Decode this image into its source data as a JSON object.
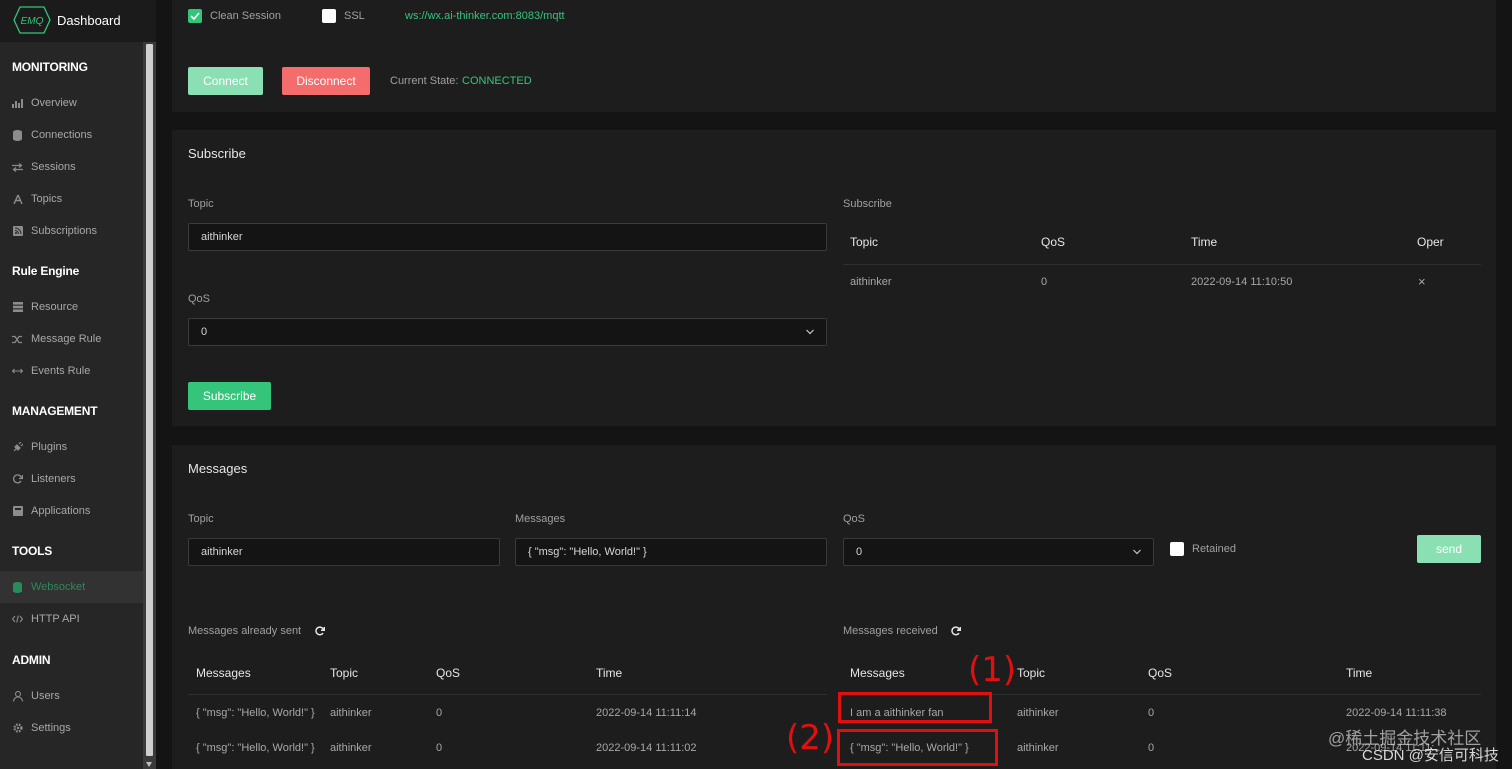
{
  "brand": {
    "logo_text": "EMQ",
    "title": "Dashboard"
  },
  "sidebar": {
    "sections": [
      {
        "label": "MONITORING",
        "items": [
          {
            "label": "Overview",
            "icon": "chart-icon"
          },
          {
            "label": "Connections",
            "icon": "database-icon"
          },
          {
            "label": "Sessions",
            "icon": "swap-icon"
          },
          {
            "label": "Topics",
            "icon": "tower-icon"
          },
          {
            "label": "Subscriptions",
            "icon": "rss-icon"
          }
        ]
      },
      {
        "label": "Rule Engine",
        "items": [
          {
            "label": "Resource",
            "icon": "server-icon"
          },
          {
            "label": "Message Rule",
            "icon": "shuffle-icon"
          },
          {
            "label": "Events Rule",
            "icon": "arrows-h-icon"
          }
        ]
      },
      {
        "label": "MANAGEMENT",
        "items": [
          {
            "label": "Plugins",
            "icon": "plug-icon"
          },
          {
            "label": "Listeners",
            "icon": "refresh-icon"
          },
          {
            "label": "Applications",
            "icon": "app-icon"
          }
        ]
      },
      {
        "label": "TOOLS",
        "items": [
          {
            "label": "Websocket",
            "icon": "websocket-icon",
            "active": true
          },
          {
            "label": "HTTP API",
            "icon": "code-icon"
          }
        ]
      },
      {
        "label": "ADMIN",
        "items": [
          {
            "label": "Users",
            "icon": "user-icon"
          },
          {
            "label": "Settings",
            "icon": "gear-icon"
          }
        ]
      }
    ]
  },
  "connection": {
    "clean_session_label": "Clean Session",
    "ssl_label": "SSL",
    "url": "ws://wx.ai-thinker.com:8083/mqtt",
    "connect_label": "Connect",
    "disconnect_label": "Disconnect",
    "state_label": "Current State:",
    "state_value": "CONNECTED"
  },
  "subscribe": {
    "title": "Subscribe",
    "topic_label": "Topic",
    "topic_value": "aithinker",
    "qos_label": "QoS",
    "qos_value": "0",
    "button_label": "Subscribe",
    "list_label": "Subscribe",
    "columns": [
      "Topic",
      "QoS",
      "Time",
      "Oper"
    ],
    "rows": [
      {
        "topic": "aithinker",
        "qos": "0",
        "time": "2022-09-14 11:10:50",
        "oper": "×"
      }
    ]
  },
  "messages": {
    "title": "Messages",
    "topic_label": "Topic",
    "topic_value": "aithinker",
    "messages_label": "Messages",
    "message_value": "{ \"msg\": \"Hello, World!\" }",
    "qos_label": "QoS",
    "qos_value": "0",
    "retained_label": "Retained",
    "send_label": "send",
    "sent_title": "Messages already sent",
    "received_title": "Messages received",
    "columns": [
      "Messages",
      "Topic",
      "QoS",
      "Time"
    ],
    "sent_rows": [
      {
        "message": "{ \"msg\": \"Hello, World!\" }",
        "topic": "aithinker",
        "qos": "0",
        "time": "2022-09-14 11:11:14"
      },
      {
        "message": "{ \"msg\": \"Hello, World!\" }",
        "topic": "aithinker",
        "qos": "0",
        "time": "2022-09-14 11:11:02"
      }
    ],
    "received_rows": [
      {
        "message": "I am a aithinker fan",
        "topic": "aithinker",
        "qos": "0",
        "time": "2022-09-14 11:11:38"
      },
      {
        "message": "{ \"msg\": \"Hello, World!\" }",
        "topic": "aithinker",
        "qos": "0",
        "time": "2022-09-14 11:11:..."
      }
    ]
  },
  "annotations": {
    "label_1": "(1)",
    "label_2": "(2)"
  },
  "watermark": {
    "line1": "@稀土掘金技术社区",
    "line2": "CSDN @安信可科技"
  },
  "colors": {
    "accent": "#35c57a",
    "danger": "#f56c6c",
    "annotation": "#e01010"
  }
}
